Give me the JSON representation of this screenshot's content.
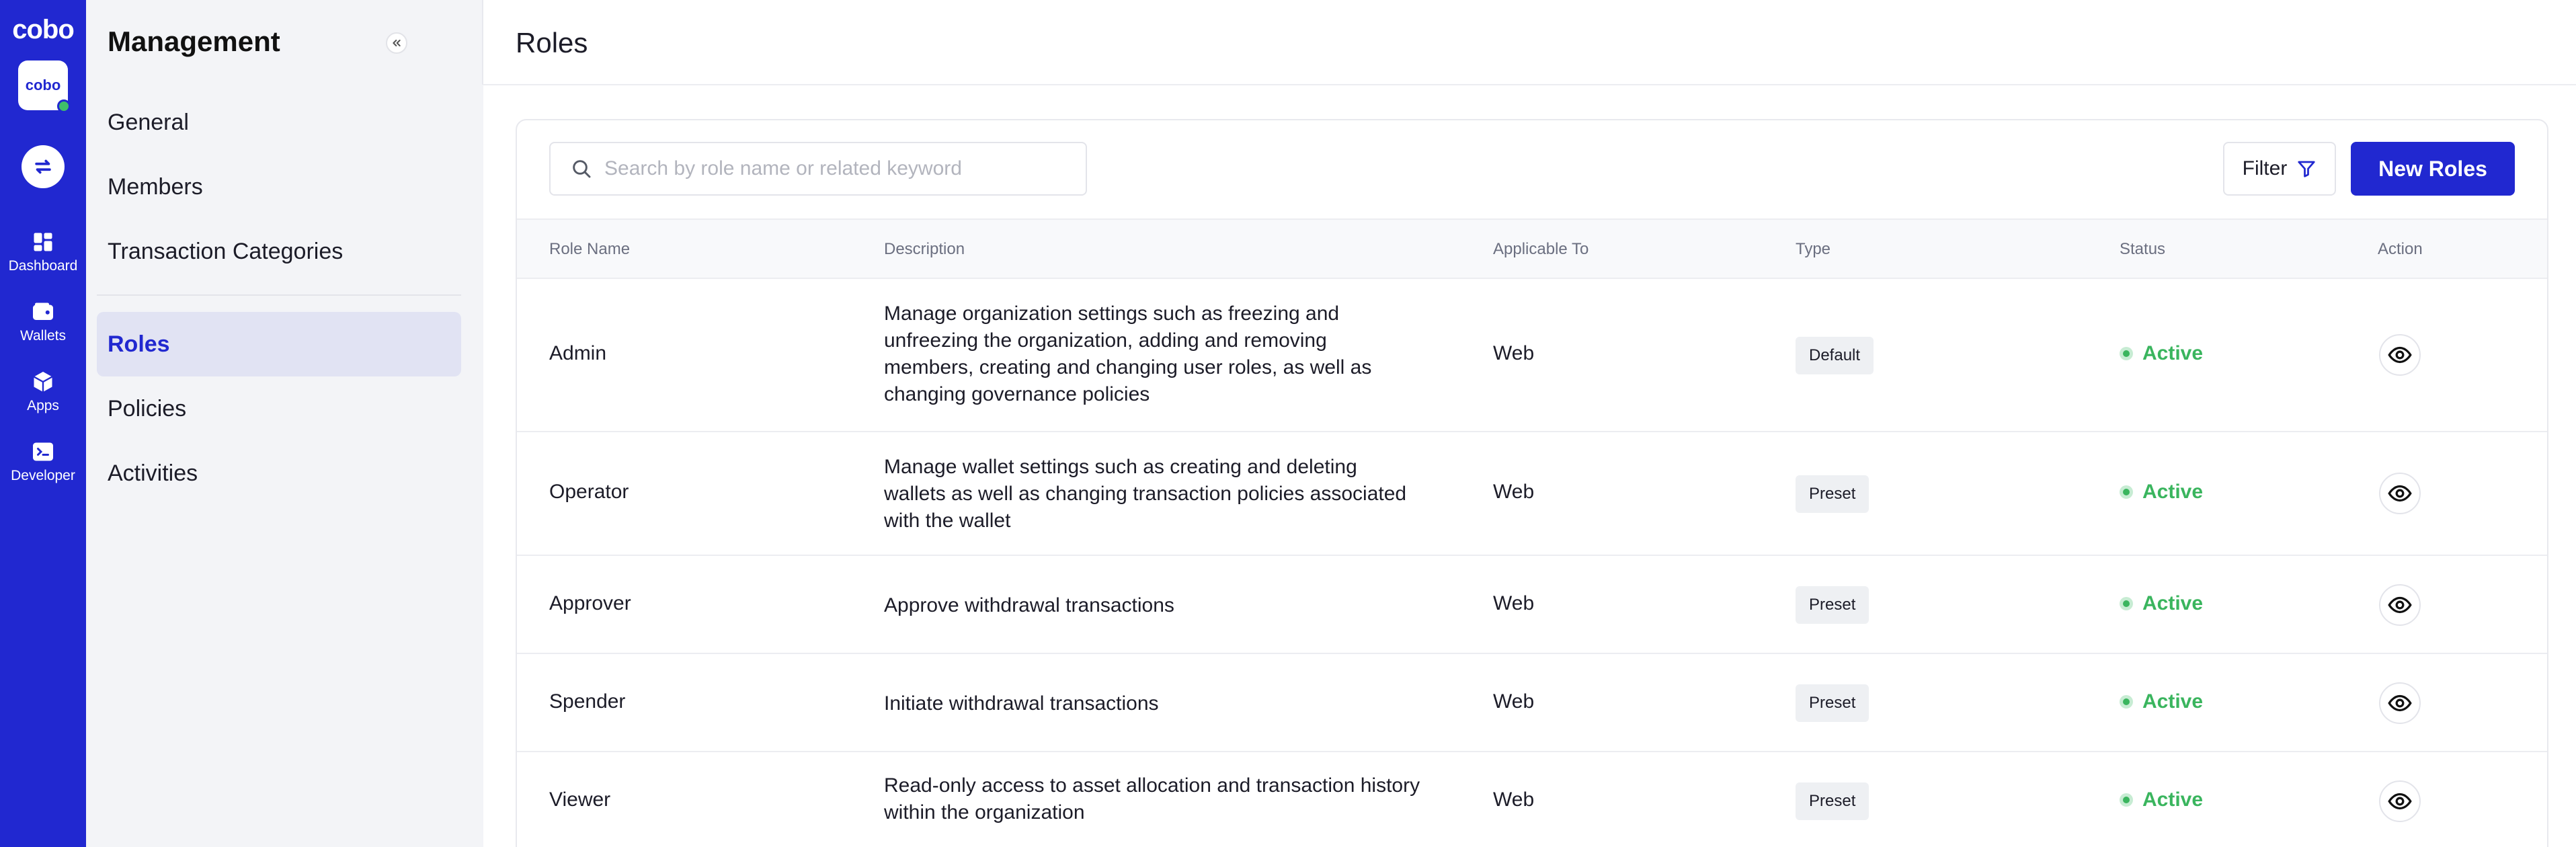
{
  "rail": {
    "logo": "cobo",
    "org_avatar": "cobo",
    "items": [
      {
        "label": "Dashboard",
        "icon": "dashboard-icon"
      },
      {
        "label": "Wallets",
        "icon": "wallet-icon"
      },
      {
        "label": "Apps",
        "icon": "cube-icon"
      },
      {
        "label": "Developer",
        "icon": "terminal-icon"
      }
    ]
  },
  "subnav": {
    "title": "Management",
    "items": [
      {
        "label": "General"
      },
      {
        "label": "Members"
      },
      {
        "label": "Transaction Categories"
      },
      {
        "label": "Roles",
        "active": true
      },
      {
        "label": "Policies"
      },
      {
        "label": "Activities"
      }
    ]
  },
  "main": {
    "title": "Roles",
    "search": {
      "placeholder": "Search by role name or related keyword"
    },
    "filter_label": "Filter",
    "new_button_label": "New Roles"
  },
  "table": {
    "columns": [
      "Role Name",
      "Description",
      "Applicable To",
      "Type",
      "Status",
      "Action"
    ],
    "rows": [
      {
        "name": "Admin",
        "description": "Manage organization settings such as freezing and unfreezing the organization, adding and removing members, creating and changing user roles, as well as changing governance policies",
        "applicable": "Web",
        "type": "Default",
        "status": "Active"
      },
      {
        "name": "Operator",
        "description": "Manage wallet settings such as creating and deleting wallets as well as changing transaction policies associated with the wallet",
        "applicable": "Web",
        "type": "Preset",
        "status": "Active"
      },
      {
        "name": "Approver",
        "description": "Approve withdrawal transactions",
        "applicable": "Web",
        "type": "Preset",
        "status": "Active"
      },
      {
        "name": "Spender",
        "description": "Initiate withdrawal transactions",
        "applicable": "Web",
        "type": "Preset",
        "status": "Active"
      },
      {
        "name": "Viewer",
        "description": "Read-only access to asset allocation and transaction history within the organization",
        "applicable": "Web",
        "type": "Preset",
        "status": "Active"
      }
    ]
  },
  "colors": {
    "brand": "#2128d0",
    "active_status": "#3ab55e",
    "sidebar_bg": "#f3f4f7"
  }
}
